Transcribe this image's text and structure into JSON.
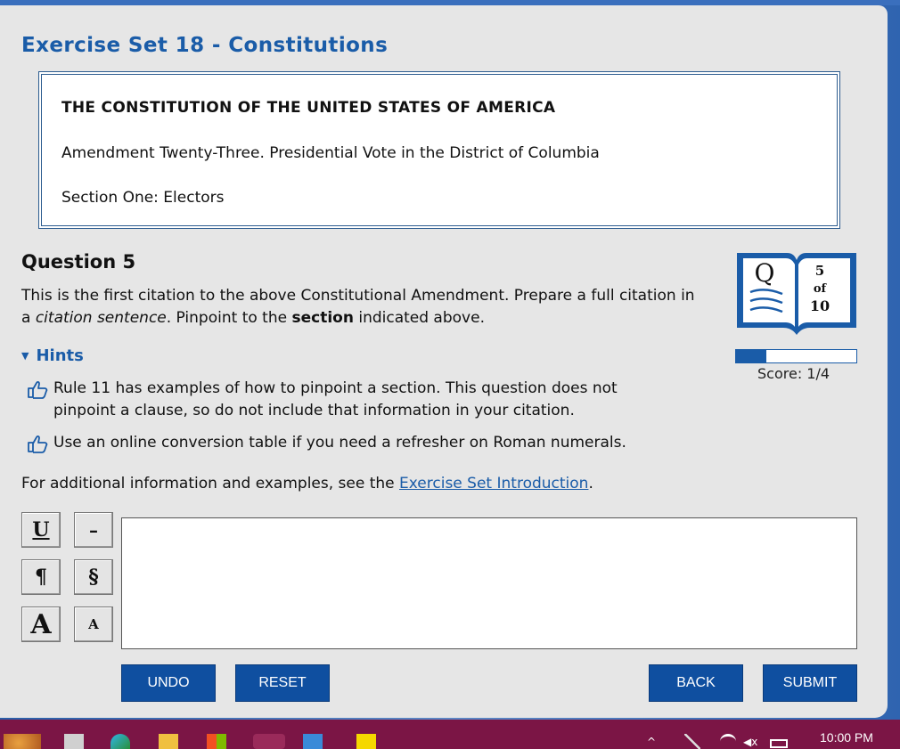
{
  "exercise": {
    "title": "Exercise Set 18 - Constitutions"
  },
  "constitution": {
    "title": "THE CONSTITUTION OF THE UNITED STATES OF AMERICA",
    "amendment": "Amendment Twenty-Three. Presidential Vote in the District of Columbia",
    "section": "Section One: Electors"
  },
  "question": {
    "heading": "Question 5",
    "text_part1": "This is the first citation to the above Constitutional Amendment. Prepare a full citation in a ",
    "text_italic": "citation sentence",
    "text_part2": ". Pinpoint to the ",
    "text_bold": "section",
    "text_part3": " indicated above."
  },
  "hints": {
    "label": "Hints",
    "items": [
      "Rule 11 has examples of how to pinpoint a section. This question does not pinpoint a clause, so do not include that information in your citation.",
      "Use an online conversion table if you need a refresher on Roman numerals."
    ]
  },
  "additional": {
    "prefix": "For additional information and examples, see the ",
    "link": "Exercise Set Introduction",
    "suffix": "."
  },
  "progress": {
    "q_letter": "Q",
    "current": "5",
    "of_label": "of",
    "total": "10",
    "fraction_complete": 0.25,
    "score_label": "Score: 1/4"
  },
  "format_buttons": {
    "underline": "U",
    "dash": "–",
    "paragraph": "¶",
    "section": "§",
    "large_caps": "A",
    "small_caps": "A"
  },
  "actions": {
    "undo": "UNDO",
    "reset": "RESET",
    "back": "BACK",
    "submit": "SUBMIT"
  },
  "taskbar": {
    "time": "10:00 PM"
  },
  "colors": {
    "accent": "#1a5ca8",
    "button": "#0f4fa0",
    "taskbar": "#7b1545",
    "panel": "#e6e6e6"
  }
}
